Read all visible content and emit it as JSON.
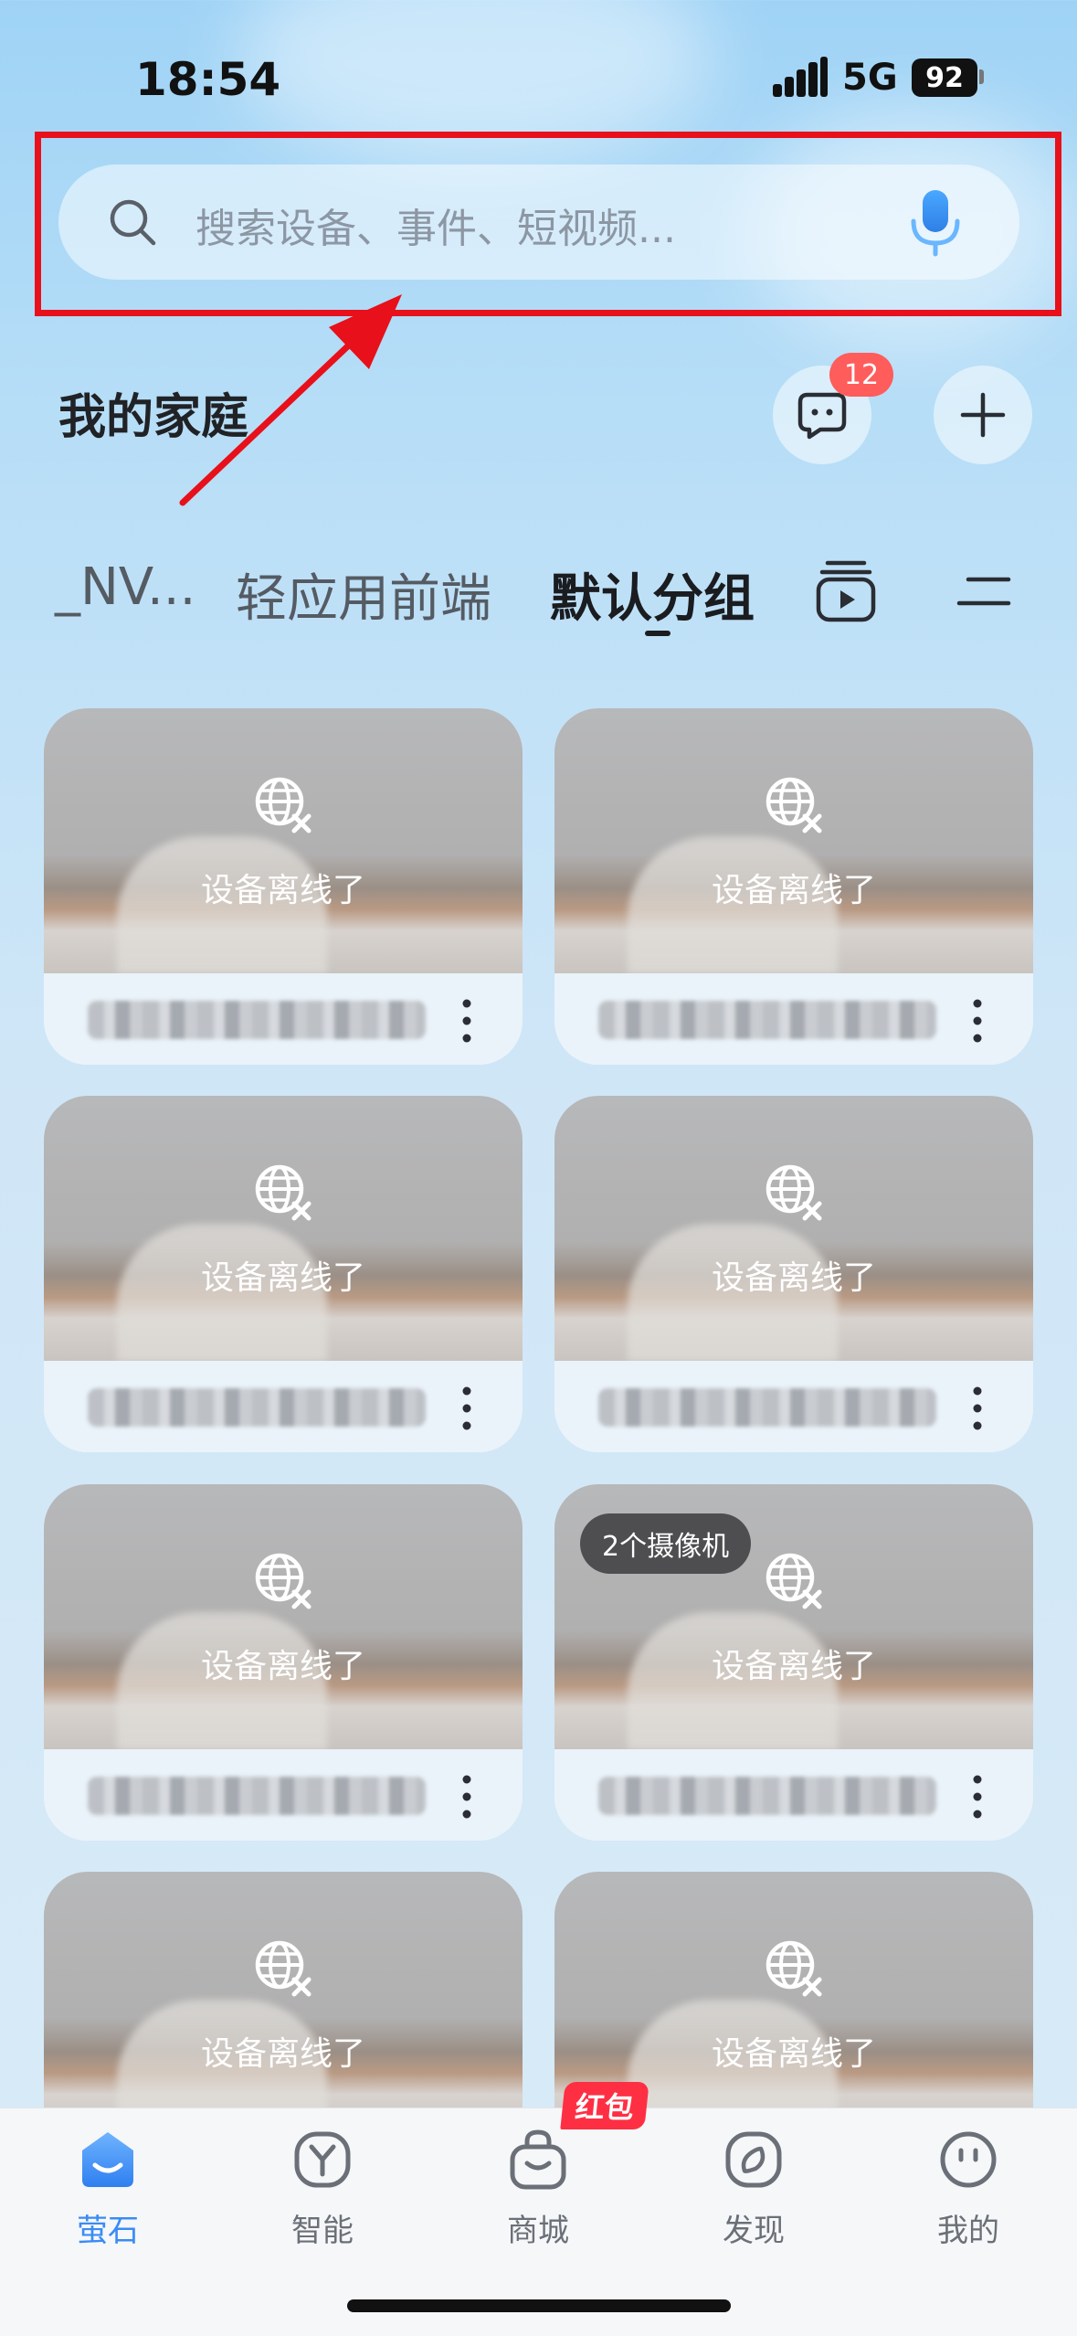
{
  "status_bar": {
    "time": "18:54",
    "network": "5G",
    "battery": "92"
  },
  "search": {
    "placeholder": "搜索设备、事件、短视频..."
  },
  "home": {
    "title": "我的家庭",
    "message_badge": "12"
  },
  "tabs": [
    {
      "label": "_NV..."
    },
    {
      "label": "轻应用前端"
    },
    {
      "label": "默认分组",
      "active": true
    }
  ],
  "devices": [
    {
      "status": "设备离线了"
    },
    {
      "status": "设备离线了"
    },
    {
      "status": "设备离线了"
    },
    {
      "status": "设备离线了"
    },
    {
      "status": "设备离线了"
    },
    {
      "status": "设备离线了",
      "badge": "2个摄像机"
    },
    {
      "status": "设备离线了"
    },
    {
      "status": "设备离线了"
    }
  ],
  "bottom_nav": [
    {
      "label": "萤石",
      "icon": "home-stone-icon",
      "active": true
    },
    {
      "label": "智能",
      "icon": "smart-icon"
    },
    {
      "label": "商城",
      "icon": "shop-bag-icon",
      "tag": "红包"
    },
    {
      "label": "发现",
      "icon": "discover-icon"
    },
    {
      "label": "我的",
      "icon": "profile-face-icon"
    }
  ],
  "colors": {
    "accent": "#3a8cf5",
    "highlight": "#e8101a",
    "badge": "#ff5c5c"
  }
}
